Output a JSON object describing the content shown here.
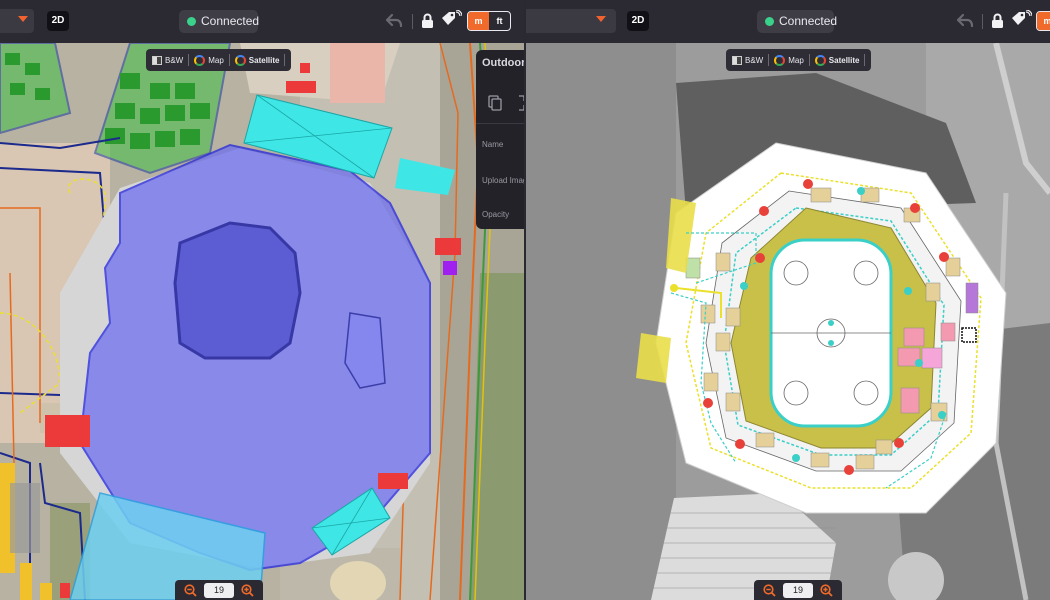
{
  "left_pane": {
    "topbar": {
      "view_mode": "2D",
      "connection_status": "Connected",
      "units": [
        "m",
        "ft"
      ],
      "active_unit": "m"
    },
    "layers": {
      "bw_label": "B&W",
      "map_label": "Map",
      "satellite_label": "Satellite",
      "active": "Satellite"
    },
    "side_panel": {
      "title": "Outdoor",
      "name_label": "Name",
      "upload_label": "Upload Imag",
      "opacity_label": "Opacity"
    },
    "zoom": {
      "level": "19"
    }
  },
  "right_pane": {
    "topbar": {
      "view_mode": "2D",
      "connection_status": "Connected",
      "units": [
        "m"
      ],
      "active_unit": "m"
    },
    "layers": {
      "bw_label": "B&W",
      "map_label": "Map",
      "satellite_label": "Satellite",
      "active": "Satellite"
    },
    "zoom": {
      "level": "19"
    }
  },
  "colors": {
    "accent": "#f06a2b",
    "connected": "#3ad18a",
    "toolbar_bg": "#2b2a32",
    "building_overlay": "#6b6cf0",
    "cyan_zone": "#3ee6e6",
    "green_zone": "#3fbf45",
    "red_zone": "#ec3a3a",
    "court_yellow": "#c9c04a"
  }
}
